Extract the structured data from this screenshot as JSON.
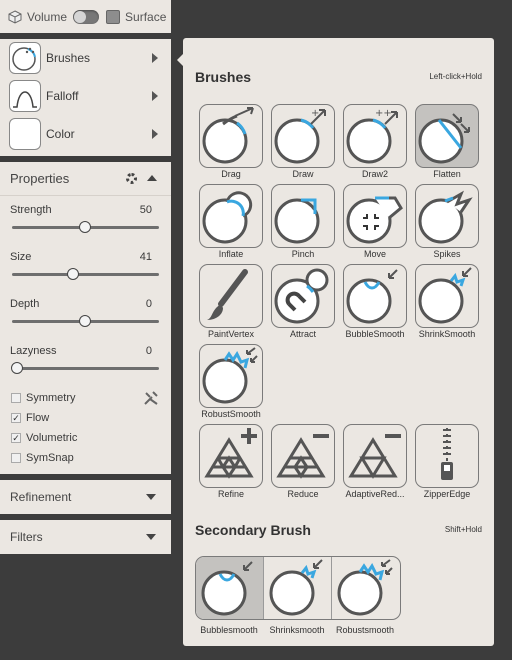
{
  "top_bar": {
    "volume_label": "Volume",
    "surface_label": "Surface"
  },
  "tools": [
    {
      "label": "Brushes",
      "icon": "brush-sphere-icon"
    },
    {
      "label": "Falloff",
      "icon": "falloff-curve-icon"
    },
    {
      "label": "Color",
      "icon": "color-swatch-icon"
    }
  ],
  "properties": {
    "title": "Properties",
    "sliders": [
      {
        "label": "Strength",
        "value": "50",
        "fraction": 0.5
      },
      {
        "label": "Size",
        "value": "41",
        "fraction": 0.41
      },
      {
        "label": "Depth",
        "value": "0",
        "fraction": 0.5
      },
      {
        "label": "Lazyness",
        "value": "0",
        "fraction": 0.0
      }
    ],
    "checkboxes": [
      {
        "label": "Symmetry",
        "checked": false
      },
      {
        "label": "Flow",
        "checked": true
      },
      {
        "label": "Volumetric",
        "checked": true
      },
      {
        "label": "SymSnap",
        "checked": false
      }
    ]
  },
  "refinement": {
    "label": "Refinement"
  },
  "filters": {
    "label": "Filters"
  },
  "brushes": {
    "title": "Brushes",
    "hint": "Left-click+Hold",
    "items": [
      {
        "label": "Drag",
        "icon": "drag-icon"
      },
      {
        "label": "Draw",
        "icon": "draw-icon"
      },
      {
        "label": "Draw2",
        "icon": "draw2-icon"
      },
      {
        "label": "Flatten",
        "icon": "flatten-icon",
        "selected": true
      },
      {
        "label": "Inflate",
        "icon": "inflate-icon"
      },
      {
        "label": "Pinch",
        "icon": "pinch-icon"
      },
      {
        "label": "Move",
        "icon": "move-icon"
      },
      {
        "label": "Spikes",
        "icon": "spikes-icon"
      },
      {
        "label": "PaintVertex",
        "icon": "paint-vertex-icon"
      },
      {
        "label": "Attract",
        "icon": "attract-icon"
      },
      {
        "label": "BubbleSmooth",
        "icon": "bubble-smooth-icon"
      },
      {
        "label": "ShrinkSmooth",
        "icon": "shrink-smooth-icon"
      },
      {
        "label": "RobustSmooth",
        "icon": "robust-smooth-icon"
      },
      {
        "label": "Refine",
        "icon": "refine-icon"
      },
      {
        "label": "Reduce",
        "icon": "reduce-icon"
      },
      {
        "label": "AdaptiveRed...",
        "icon": "adaptive-reduce-icon"
      },
      {
        "label": "ZipperEdge",
        "icon": "zipper-edge-icon"
      }
    ]
  },
  "secondary": {
    "title": "Secondary Brush",
    "hint": "Shift+Hold",
    "items": [
      {
        "label": "Bubblesmooth",
        "icon": "bubble-smooth-icon",
        "selected": true
      },
      {
        "label": "Shrinksmooth",
        "icon": "shrink-smooth-icon"
      },
      {
        "label": "Robustsmooth",
        "icon": "robust-smooth-icon"
      }
    ]
  },
  "colors": {
    "panel_bg": "#ebe7e2",
    "accent_blue": "#3aa7e0",
    "dark_bg": "#3c3c3c"
  }
}
